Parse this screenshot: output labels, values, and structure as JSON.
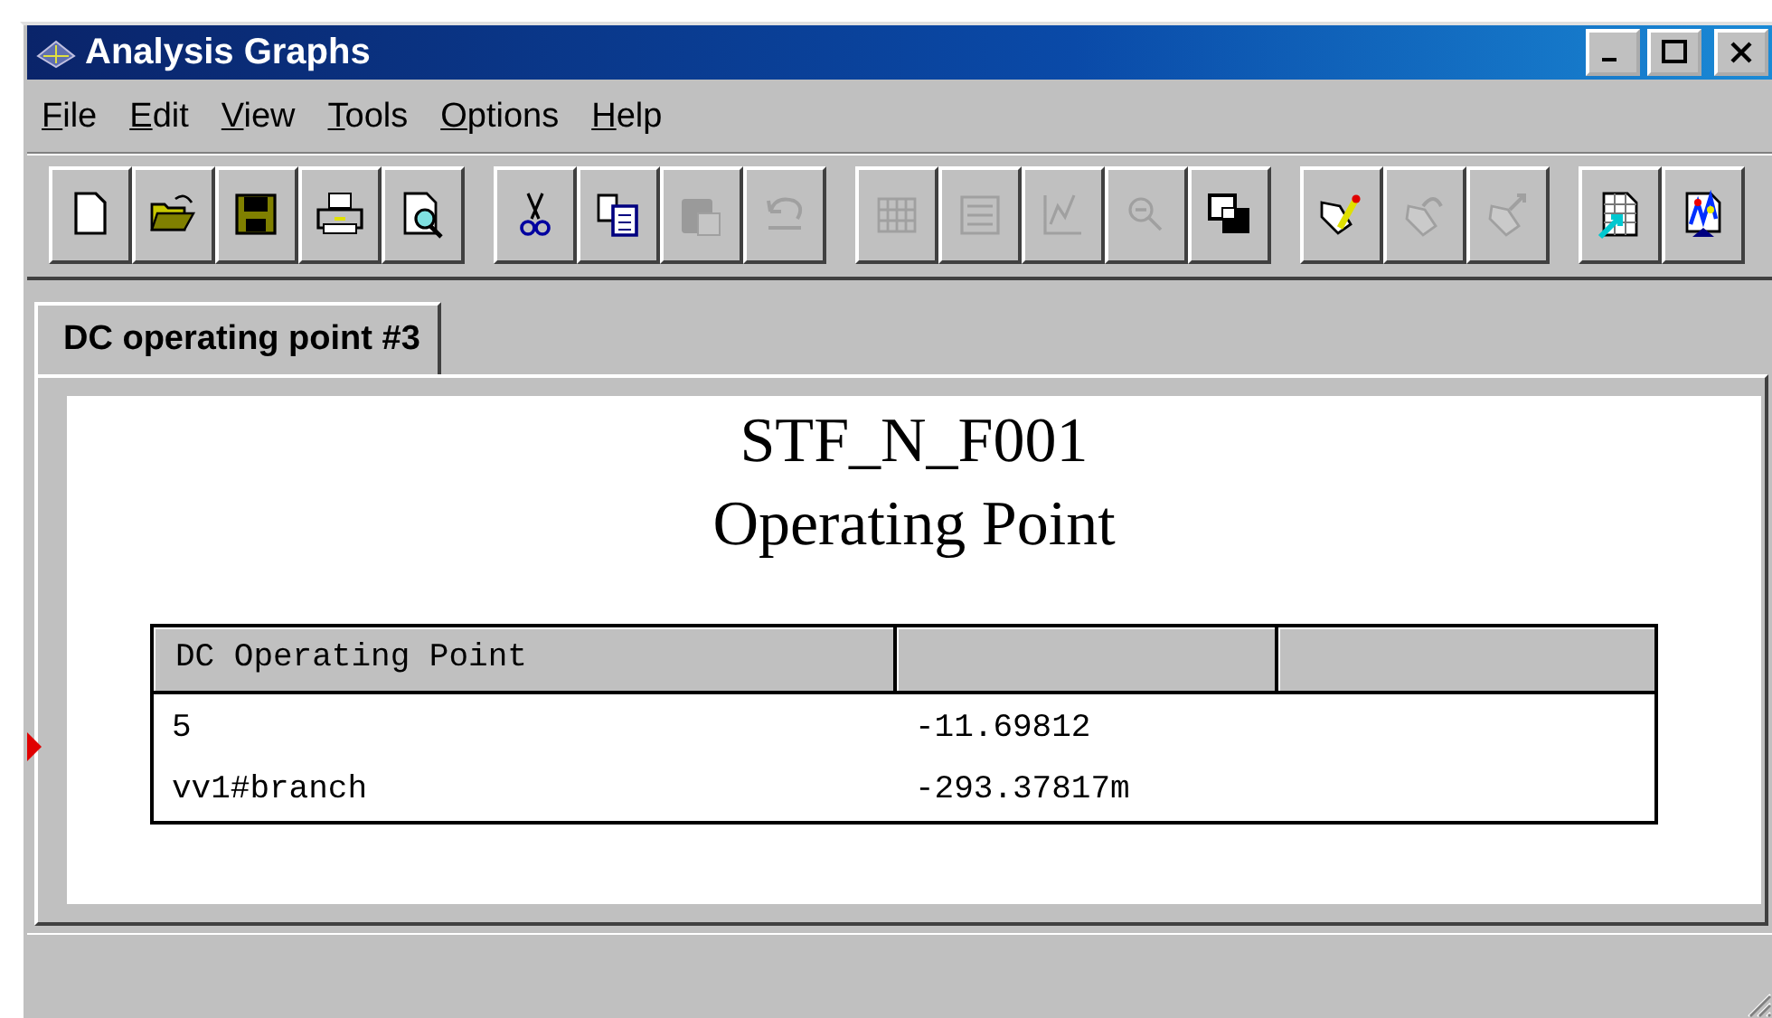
{
  "window": {
    "title": "Analysis Graphs"
  },
  "menu": [
    {
      "label": "File"
    },
    {
      "label": "Edit"
    },
    {
      "label": "View"
    },
    {
      "label": "Tools"
    },
    {
      "label": "Options"
    },
    {
      "label": "Help"
    }
  ],
  "toolbar": [
    [
      {
        "kind": "new",
        "disabled": false
      },
      {
        "kind": "open",
        "disabled": false
      },
      {
        "kind": "save",
        "disabled": false
      },
      {
        "kind": "print",
        "disabled": false
      },
      {
        "kind": "preview",
        "disabled": false
      }
    ],
    [
      {
        "kind": "cut",
        "disabled": false
      },
      {
        "kind": "copy",
        "disabled": false
      },
      {
        "kind": "paste",
        "disabled": true
      },
      {
        "kind": "undo",
        "disabled": true
      }
    ],
    [
      {
        "kind": "grid",
        "disabled": true
      },
      {
        "kind": "list",
        "disabled": true
      },
      {
        "kind": "chart",
        "disabled": true
      },
      {
        "kind": "zoom",
        "disabled": true
      },
      {
        "kind": "overlay",
        "disabled": false
      }
    ],
    [
      {
        "kind": "tag-edit",
        "disabled": false
      },
      {
        "kind": "tag-rotate",
        "disabled": true
      },
      {
        "kind": "tag-pick",
        "disabled": true
      }
    ],
    [
      {
        "kind": "export",
        "disabled": false
      },
      {
        "kind": "graph",
        "disabled": false
      }
    ]
  ],
  "tabs": [
    {
      "label": "DC operating point #3",
      "selected": true
    }
  ],
  "plot": {
    "title": "STF_N_F001",
    "subtitle": "Operating Point",
    "table": {
      "columns": [
        "DC Operating Point",
        "",
        ""
      ],
      "rows": [
        {
          "cells": [
            "5",
            "-11.69812",
            ""
          ],
          "selected": true
        },
        {
          "cells": [
            "vv1#branch",
            "-293.37817m",
            ""
          ],
          "selected": false
        }
      ]
    }
  }
}
